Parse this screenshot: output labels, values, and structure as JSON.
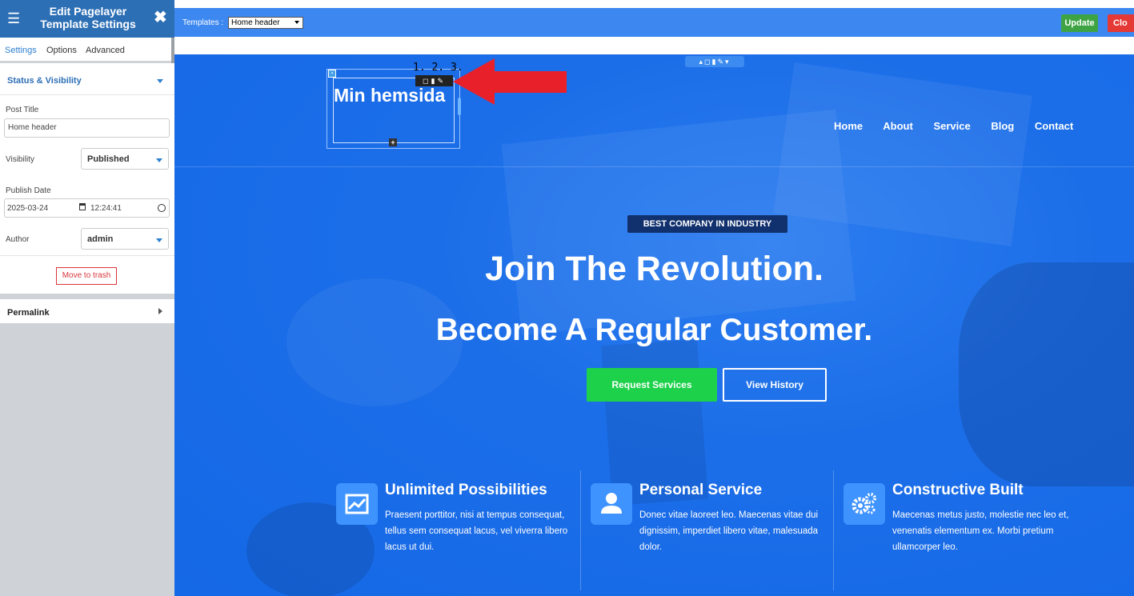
{
  "sidebar": {
    "title": "Edit Pagelayer Template Settings",
    "tabs": [
      "Settings",
      "Options",
      "Advanced"
    ],
    "section_status": "Status & Visibility",
    "post_title_label": "Post Title",
    "post_title_value": "Home header",
    "visibility_label": "Visibility",
    "visibility_value": "Published",
    "publish_date_label": "Publish Date",
    "publish_date": "2025-03-24",
    "publish_time": "12:24:41",
    "author_label": "Author",
    "author_value": "admin",
    "trash_label": "Move to trash",
    "section_permalink": "Permalink",
    "toggle": "‹"
  },
  "topbar": {
    "templates_label": "Templates :",
    "template_selected": "Home header",
    "update_label": "Update",
    "close_label": "Clo"
  },
  "editor": {
    "logo_text": "Min hemsida",
    "step_numbers": "1. 2. 3.",
    "arrow_color": "#e8202a"
  },
  "site": {
    "nav": [
      "Home",
      "About",
      "Service",
      "Blog",
      "Contact"
    ],
    "badge": "BEST COMPANY IN INDUSTRY",
    "headline1": "Join The Revolution.",
    "headline2": "Become A Regular Customer.",
    "btn_primary": "Request Services",
    "btn_secondary": "View History",
    "features": [
      {
        "icon": "chart-icon",
        "title": "Unlimited Possibilities",
        "text": "Praesent porttitor, nisi at tempus consequat, tellus sem consequat lacus, vel viverra libero lacus ut dui."
      },
      {
        "icon": "user-icon",
        "title": "Personal Service",
        "text": "Donec vitae laoreet leo. Maecenas vitae dui dignissim, imperdiet libero vitae, malesuada dolor."
      },
      {
        "icon": "gears-icon",
        "title": "Constructive Built",
        "text": "Maecenas metus justo, molestie nec leo et, venenatis elementum ex. Morbi pretium ullamcorper leo."
      }
    ]
  },
  "colors": {
    "sidebar_header": "#2d6fb5",
    "topbar": "#3d88f0",
    "hero": "#1c6ee8",
    "update": "#3ea443",
    "close": "#e53935",
    "primary_btn": "#1ed14b",
    "badge": "#11316e"
  }
}
